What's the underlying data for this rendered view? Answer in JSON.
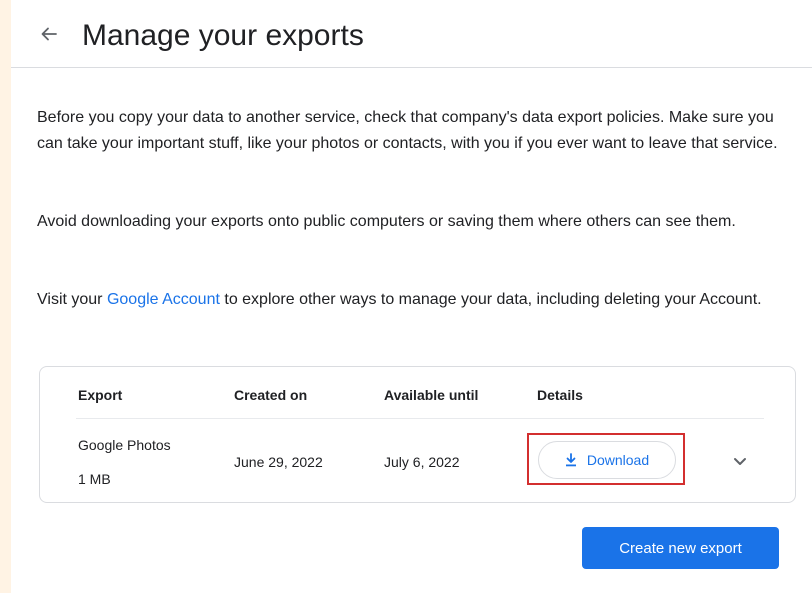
{
  "header": {
    "back_icon": "arrow-left-icon",
    "title": "Manage your exports"
  },
  "intro": {
    "p1": "Before you copy your data to another service, check that company's data export policies. Make sure you can take your important stuff, like your photos or contacts, with you if you ever want to leave that service.",
    "p2": "Avoid downloading your exports onto public computers or saving them where others can see them.",
    "p3_before": "Visit your ",
    "p3_link": "Google Account",
    "p3_after": " to explore other ways to manage your data, including deleting your Account."
  },
  "table": {
    "headers": [
      "Export",
      "Created on",
      "Available until",
      "Details"
    ],
    "rows": [
      {
        "export_name": "Google Photos",
        "size": "1 MB",
        "created_on": "June 29, 2022",
        "available_until": "July 6, 2022",
        "download_label": "Download",
        "download_icon": "download-icon",
        "expand_icon": "chevron-down-icon"
      }
    ]
  },
  "actions": {
    "create_label": "Create new export"
  },
  "colors": {
    "accent": "#1a73e8",
    "highlight": "#d32f2f",
    "background": "#fff3e4"
  }
}
